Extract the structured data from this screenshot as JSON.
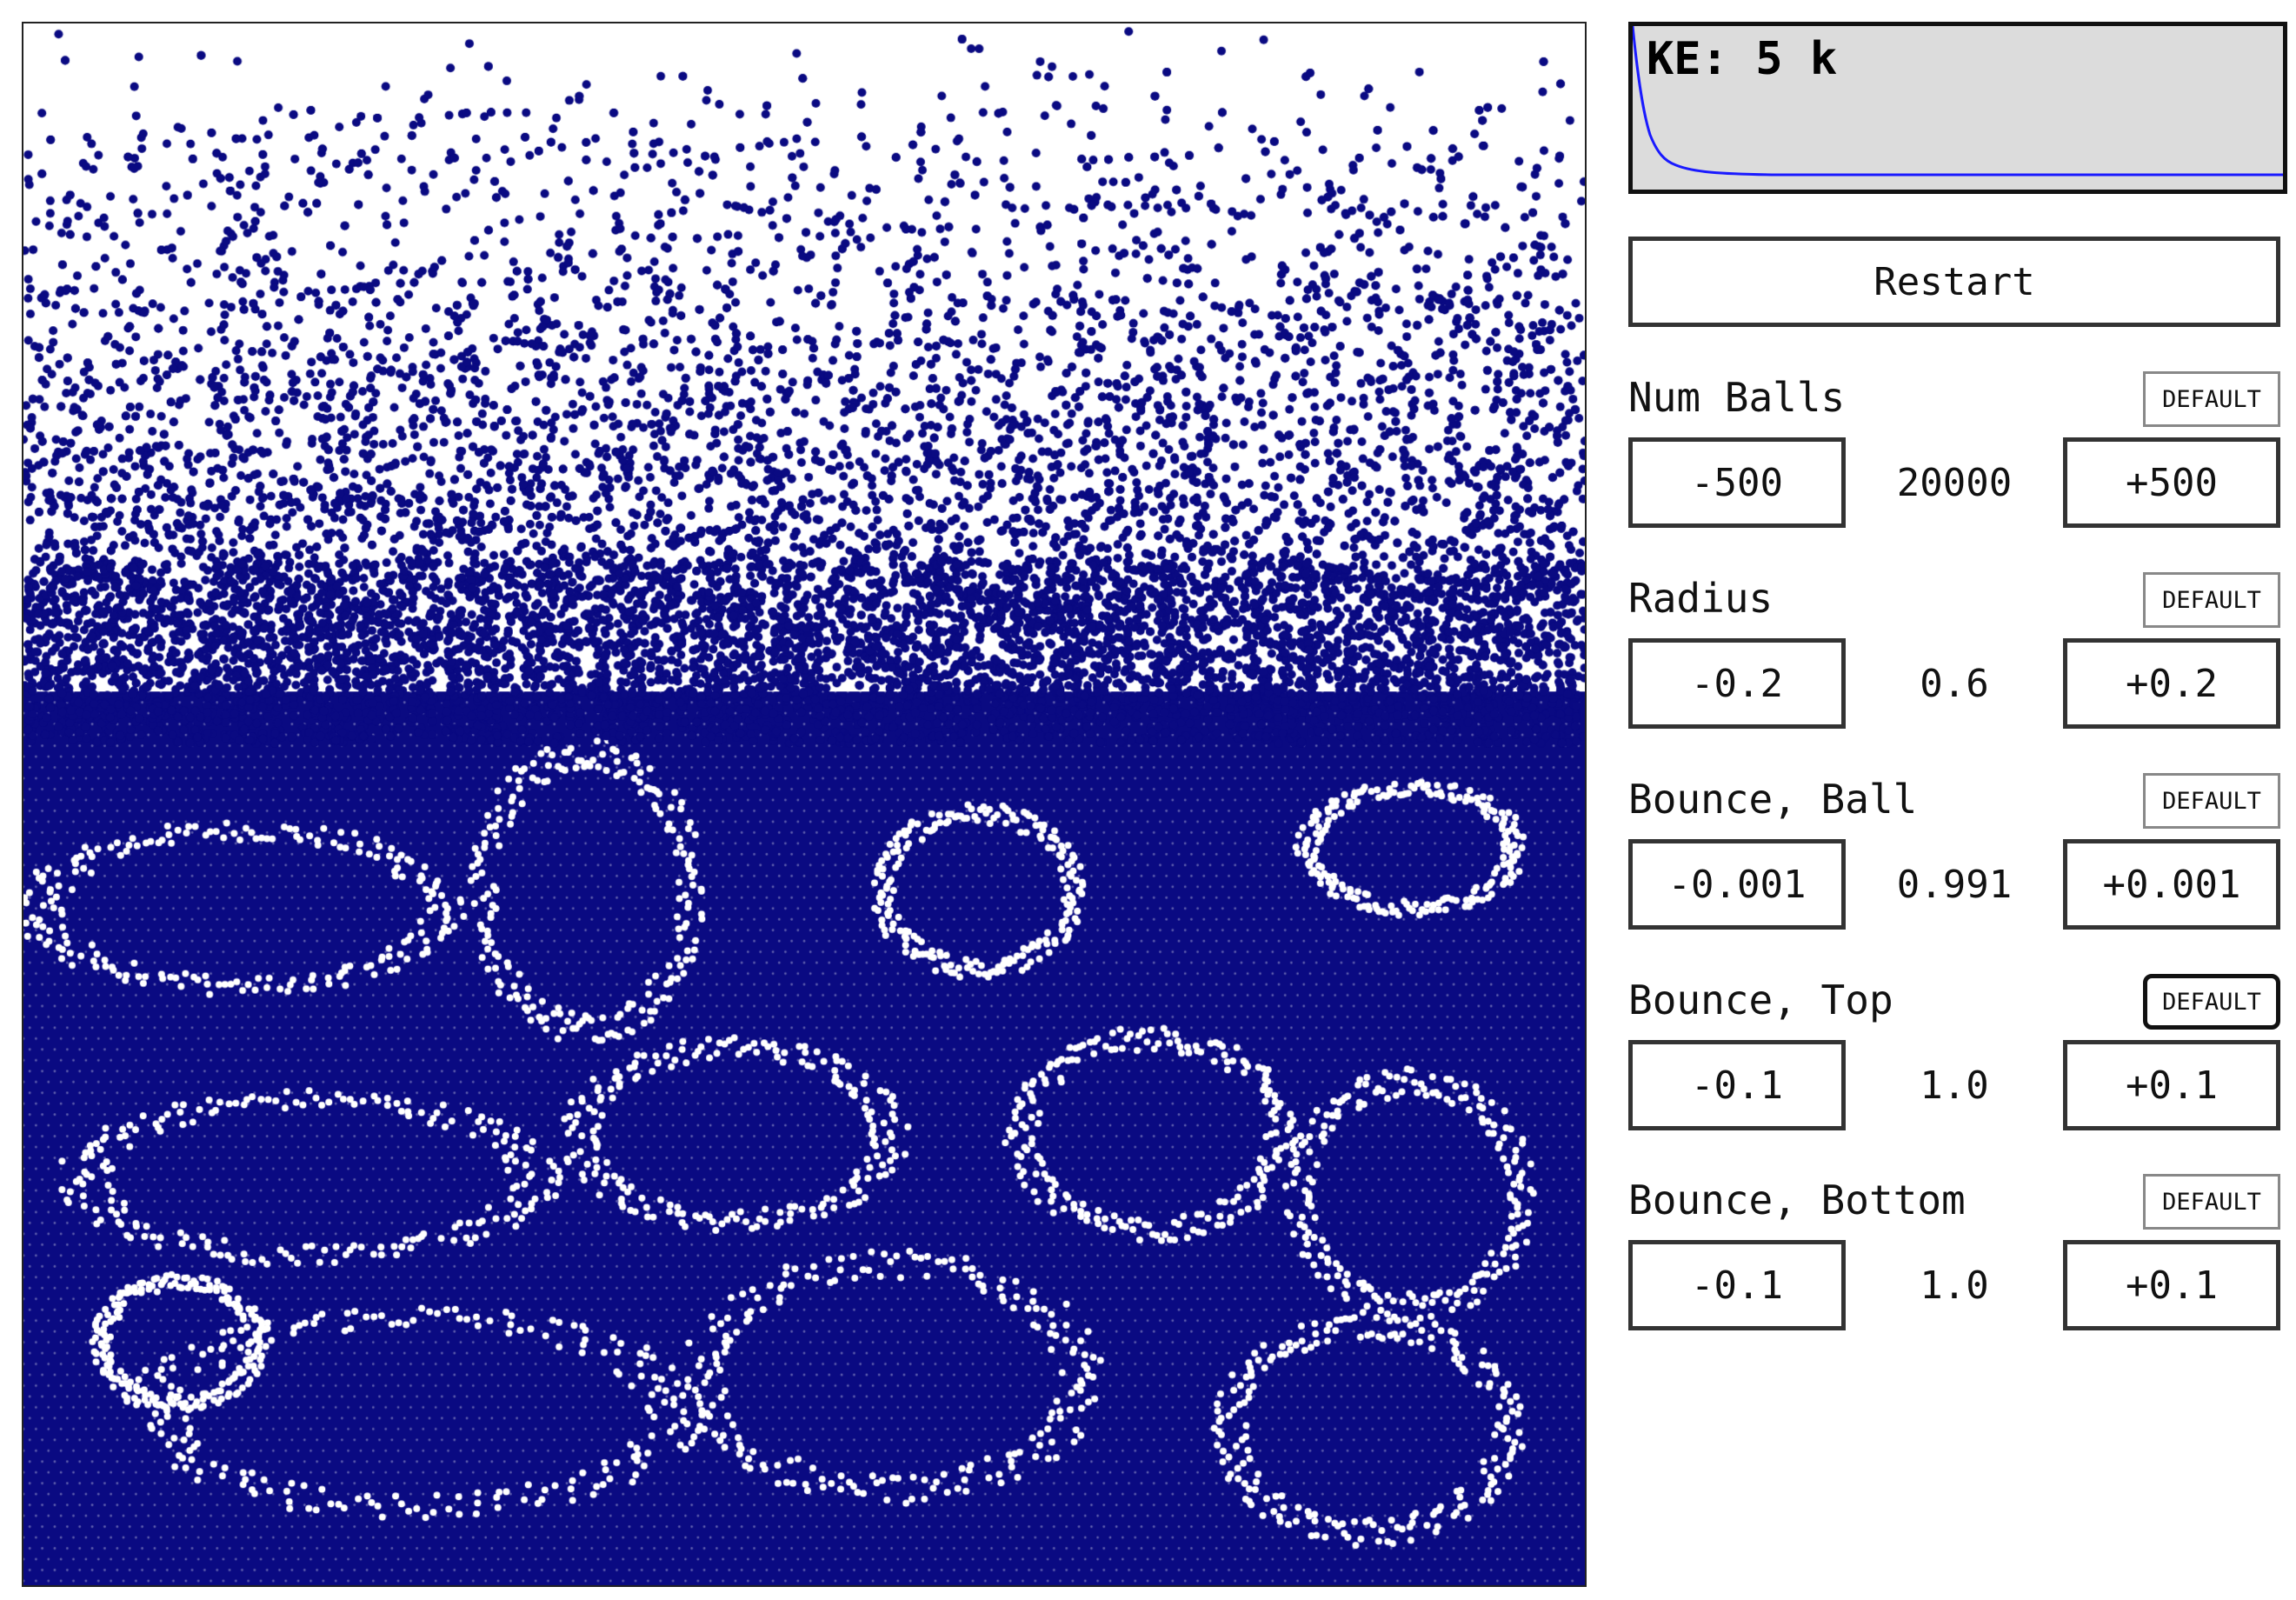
{
  "ke_graph": {
    "label": "KE: 5 k",
    "line_color": "#1a1aff"
  },
  "restart": {
    "label": "Restart"
  },
  "ball_color": "#0a0a82",
  "controls": [
    {
      "id": "num-balls",
      "label": "Num Balls",
      "default_label": "DEFAULT",
      "dec": "-500",
      "value": "20000",
      "inc": "+500",
      "default_active": false
    },
    {
      "id": "radius",
      "label": "Radius",
      "default_label": "DEFAULT",
      "dec": "-0.2",
      "value": "0.6",
      "inc": "+0.2",
      "default_active": false
    },
    {
      "id": "bounce-ball",
      "label": "Bounce, Ball",
      "default_label": "DEFAULT",
      "dec": "-0.001",
      "value": "0.991",
      "inc": "+0.001",
      "default_active": false
    },
    {
      "id": "bounce-top",
      "label": "Bounce, Top",
      "default_label": "DEFAULT",
      "dec": "-0.1",
      "value": "1.0",
      "inc": "+0.1",
      "default_active": true
    },
    {
      "id": "bounce-bottom",
      "label": "Bounce, Bottom",
      "default_label": "DEFAULT",
      "dec": "-0.1",
      "value": "1.0",
      "inc": "+0.1",
      "default_active": false
    }
  ]
}
